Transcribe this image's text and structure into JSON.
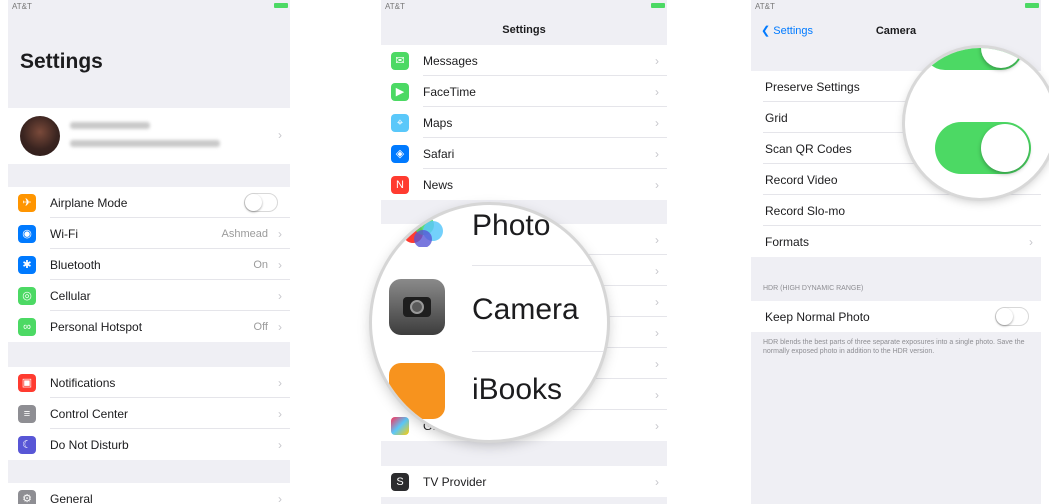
{
  "colors": {
    "accent": "#007aff",
    "toggle_on": "#4cd964",
    "background": "#efeff4"
  },
  "panel1": {
    "status_left": "AT&T",
    "title": "Settings",
    "profile_icon": "avatar",
    "groups": [
      [
        {
          "label": "Airplane Mode",
          "icon": "airplane-icon",
          "color": "#ff9500",
          "glyph": "✈",
          "toggle": true,
          "toggle_on": false
        },
        {
          "label": "Wi-Fi",
          "icon": "wifi-icon",
          "color": "#007aff",
          "glyph": "◉",
          "value": "Ashmead"
        },
        {
          "label": "Bluetooth",
          "icon": "bluetooth-icon",
          "color": "#007aff",
          "glyph": "✱",
          "value": "On"
        },
        {
          "label": "Cellular",
          "icon": "cellular-icon",
          "color": "#4cd964",
          "glyph": "◎",
          "value": ""
        },
        {
          "label": "Personal Hotspot",
          "icon": "hotspot-icon",
          "color": "#4cd964",
          "glyph": "∞",
          "value": "Off"
        }
      ],
      [
        {
          "label": "Notifications",
          "icon": "notifications-icon",
          "color": "#ff3b30",
          "glyph": "▣",
          "value": ""
        },
        {
          "label": "Control Center",
          "icon": "control-center-icon",
          "color": "#8e8e93",
          "glyph": "≡",
          "value": ""
        },
        {
          "label": "Do Not Disturb",
          "icon": "moon-icon",
          "color": "#5856d6",
          "glyph": "☾",
          "value": ""
        }
      ],
      [
        {
          "label": "General",
          "icon": "gear-icon",
          "color": "#8e8e93",
          "glyph": "⚙",
          "value": ""
        }
      ]
    ]
  },
  "panel2": {
    "status_left": "AT&T",
    "title": "Settings",
    "rows": [
      {
        "label": "Messages",
        "icon": "messages-icon",
        "color": "#4cd964",
        "glyph": "✉"
      },
      {
        "label": "FaceTime",
        "icon": "facetime-icon",
        "color": "#4cd964",
        "glyph": "▶"
      },
      {
        "label": "Maps",
        "icon": "maps-icon",
        "color": "#5ac8fa",
        "glyph": "⌖"
      },
      {
        "label": "Safari",
        "icon": "safari-icon",
        "color": "#007aff",
        "glyph": "◈"
      },
      {
        "label": "News",
        "icon": "news-icon",
        "color": "#ff3b30",
        "glyph": "N"
      }
    ],
    "magnifier_labels": [
      "Photo",
      "Camera",
      "iBooks"
    ],
    "game_center": {
      "label": "Game Center",
      "icon": "game-center-icon"
    },
    "tv_provider": {
      "label": "TV Provider",
      "icon": "tv-provider-icon",
      "glyph": "S"
    }
  },
  "panel3": {
    "status_left": "AT&T",
    "back_label": "Settings",
    "title": "Camera",
    "rows": [
      {
        "label": "Preserve Settings"
      },
      {
        "label": "Grid"
      },
      {
        "label": "Scan QR Codes"
      },
      {
        "label": "Record Video"
      },
      {
        "label": "Record Slo-mo"
      },
      {
        "label": "Formats"
      }
    ],
    "hdr_header": "HDR (HIGH DYNAMIC RANGE)",
    "keep_normal": "Keep Normal Photo",
    "hdr_note": "HDR blends the best parts of three separate exposures into a single photo. Save the normally exposed photo in addition to the HDR version."
  }
}
